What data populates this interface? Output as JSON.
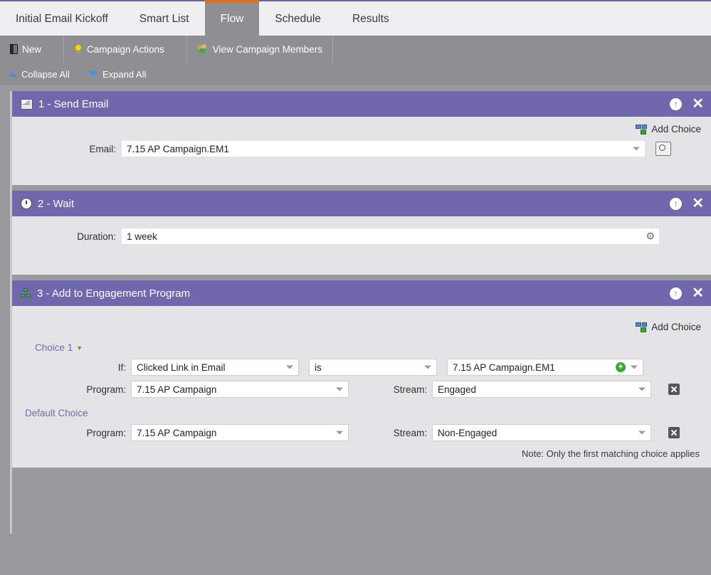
{
  "tabs": [
    {
      "label": "Initial Email Kickoff",
      "active": false
    },
    {
      "label": "Smart List",
      "active": false
    },
    {
      "label": "Flow",
      "active": true
    },
    {
      "label": "Schedule",
      "active": false
    },
    {
      "label": "Results",
      "active": false
    }
  ],
  "toolbar": {
    "new_label": "New",
    "campaign_actions_label": "Campaign Actions",
    "view_members_label": "View Campaign Members",
    "collapse_all_label": "Collapse All",
    "expand_all_label": "Expand All"
  },
  "steps": [
    {
      "title": "1 - Send Email",
      "icon": "email-icon",
      "add_choice_label": "Add Choice",
      "email_label": "Email:",
      "email_value": "7.15 AP Campaign.EM1"
    },
    {
      "title": "2 - Wait",
      "icon": "clock-icon",
      "duration_label": "Duration:",
      "duration_value": "1 week"
    },
    {
      "title": "3 - Add to Engagement Program",
      "icon": "program-icon",
      "add_choice_label": "Add Choice",
      "choice_label": "Choice 1",
      "if_label": "If:",
      "if_value": "Clicked Link in Email",
      "operator_value": "is",
      "operand_value": "7.15 AP Campaign.EM1",
      "program_label": "Program:",
      "program_value": "7.15 AP Campaign",
      "stream_label": "Stream:",
      "stream_value": "Engaged",
      "default_choice_label": "Default Choice",
      "default_program_label": "Program:",
      "default_program_value": "7.15 AP Campaign",
      "default_stream_label": "Stream:",
      "default_stream_value": "Non-Engaged",
      "note": "Note: Only the first matching choice applies"
    }
  ],
  "colors": {
    "accent_orange": "#e1701a",
    "panel_header_purple": "#6f68ad",
    "toolbar_gray": "#8e8e93",
    "body_gray": "#9a9a9e",
    "link_purple": "#6d6da8",
    "green": "#3f9e3f"
  }
}
